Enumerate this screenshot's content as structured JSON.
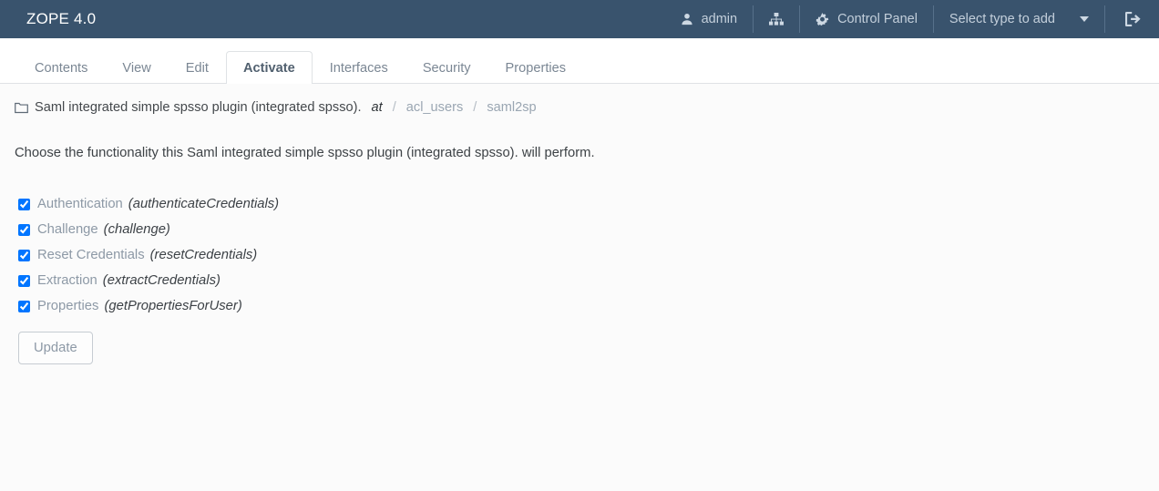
{
  "topbar": {
    "brand": "ZOPE 4.0",
    "user": {
      "label": "admin",
      "icon": "user-icon"
    },
    "sitemap": {
      "icon": "sitemap-icon"
    },
    "control_panel": {
      "label": "Control Panel",
      "icon": "gear-icon"
    },
    "add_select": {
      "label": "Select type to add",
      "caret": "chevron-down-icon"
    },
    "logout": {
      "icon": "logout-icon"
    }
  },
  "tabs": [
    {
      "label": "Contents",
      "active": false
    },
    {
      "label": "View",
      "active": false
    },
    {
      "label": "Edit",
      "active": false
    },
    {
      "label": "Activate",
      "active": true
    },
    {
      "label": "Interfaces",
      "active": false
    },
    {
      "label": "Security",
      "active": false
    },
    {
      "label": "Properties",
      "active": false
    }
  ],
  "breadcrumb": {
    "icon": "folder-icon",
    "title": "Saml integrated simple spsso plugin (integrated spsso).",
    "at": "at",
    "sep": "/",
    "links": [
      "acl_users",
      "saml2sp"
    ]
  },
  "main": {
    "lead": "Choose the functionality this Saml integrated simple spsso plugin (integrated spsso). will perform.",
    "options": [
      {
        "label": "Authentication",
        "method": "(authenticateCredentials)",
        "checked": true
      },
      {
        "label": "Challenge",
        "method": "(challenge)",
        "checked": true
      },
      {
        "label": "Reset Credentials",
        "method": "(resetCredentials)",
        "checked": true
      },
      {
        "label": "Extraction",
        "method": "(extractCredentials)",
        "checked": true
      },
      {
        "label": "Properties",
        "method": "(getPropertiesForUser)",
        "checked": true
      }
    ],
    "update_label": "Update"
  },
  "colors": {
    "header_bg": "#39536d",
    "content_bg": "#fbfbfb",
    "border": "#dfe2e5",
    "muted_text": "#8d99a6"
  }
}
